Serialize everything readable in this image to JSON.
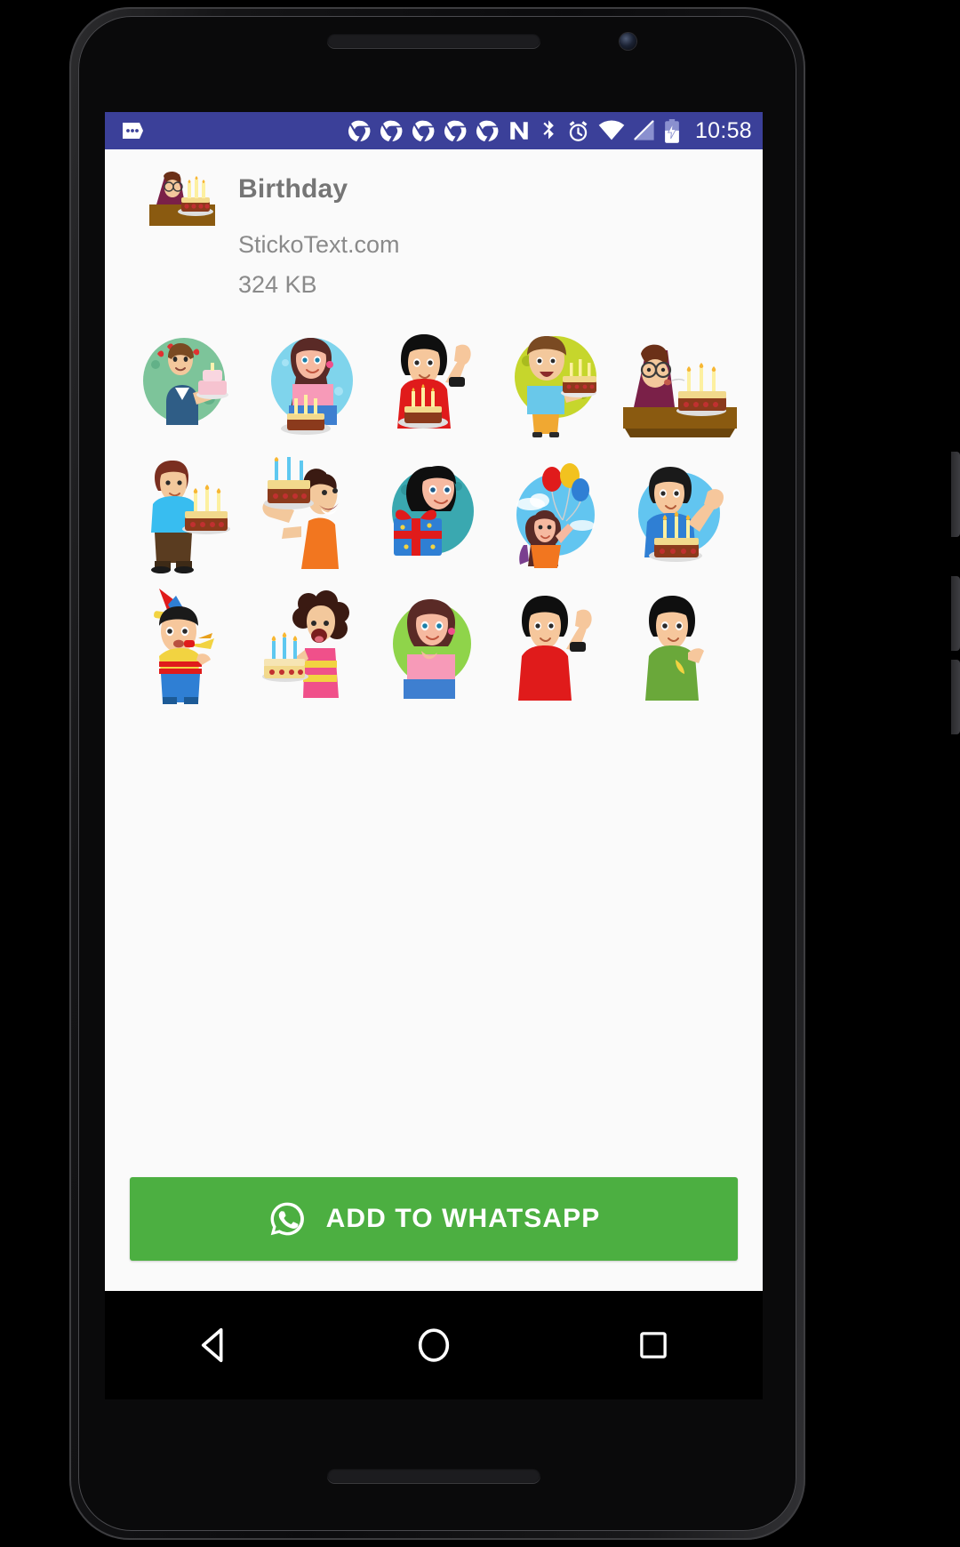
{
  "device": {
    "type": "android-phone-mockup",
    "frame_color": "#141416"
  },
  "status_bar": {
    "background": "#3b4099",
    "clock": "10:58",
    "left_icons": [
      {
        "name": "notification-more-icon",
        "glyph": "dots"
      }
    ],
    "notification_icons": [
      {
        "name": "chrome-notification-icon-1"
      },
      {
        "name": "chrome-notification-icon-2"
      },
      {
        "name": "chrome-notification-icon-3"
      },
      {
        "name": "chrome-notification-icon-4"
      },
      {
        "name": "chrome-notification-icon-5"
      },
      {
        "name": "novalauncher-notification-icon"
      }
    ],
    "system_icons": [
      {
        "name": "bluetooth-icon"
      },
      {
        "name": "alarm-icon"
      },
      {
        "name": "wifi-icon"
      },
      {
        "name": "cellular-signal-off-icon"
      },
      {
        "name": "battery-charging-icon"
      }
    ]
  },
  "pack": {
    "title": "Birthday",
    "publisher": "StickoText.com",
    "size": "324 KB",
    "tray_icon_name": "birthday-tray-icon"
  },
  "stickers": [
    {
      "index": 1,
      "name": "man-holding-pink-cake",
      "bg": "#7dc49a",
      "shape": "oval"
    },
    {
      "index": 2,
      "name": "girl-kneeling-with-cake",
      "bg": "#7fd4ec",
      "shape": "oval"
    },
    {
      "index": 3,
      "name": "boy-red-shirt-waving-cake",
      "bg": "none",
      "shape": "none"
    },
    {
      "index": 4,
      "name": "woman-blue-top-holding-cake",
      "bg": "#c6d62c",
      "shape": "oval"
    },
    {
      "index": 5,
      "name": "man-glasses-blowing-candles",
      "bg": "none",
      "shape": "none"
    },
    {
      "index": 6,
      "name": "boy-blue-shirt-carrying-cake",
      "bg": "none",
      "shape": "none"
    },
    {
      "index": 7,
      "name": "man-orange-shirt-eating-cake",
      "bg": "none",
      "shape": "none"
    },
    {
      "index": 8,
      "name": "girl-with-gift-box",
      "bg": "#3aa8b0",
      "shape": "oval"
    },
    {
      "index": 9,
      "name": "girl-with-balloons",
      "bg": "#62c5f0",
      "shape": "oval"
    },
    {
      "index": 10,
      "name": "boy-holding-cake-blue-bg",
      "bg": "#62c5f0",
      "shape": "oval"
    },
    {
      "index": 11,
      "name": "boy-party-hat-blower",
      "bg": "none",
      "shape": "none"
    },
    {
      "index": 12,
      "name": "girl-shouting-with-cake",
      "bg": "none",
      "shape": "none"
    },
    {
      "index": 13,
      "name": "girl-pink-top-green-bg",
      "bg": "#8fd44a",
      "shape": "oval"
    },
    {
      "index": 14,
      "name": "boy-red-shirt-waving",
      "bg": "none",
      "shape": "none"
    },
    {
      "index": 15,
      "name": "boy-green-shirt-waving",
      "bg": "none",
      "shape": "none"
    }
  ],
  "primary_action": {
    "label": "ADD TO WHATSAPP",
    "icon_name": "whatsapp-icon",
    "color": "#4caf41",
    "text_color": "#ffffff"
  },
  "nav_bar": {
    "background": "#000000",
    "buttons": [
      {
        "name": "nav-back-button",
        "icon": "triangle-left"
      },
      {
        "name": "nav-home-button",
        "icon": "circle"
      },
      {
        "name": "nav-recents-button",
        "icon": "square"
      }
    ]
  }
}
